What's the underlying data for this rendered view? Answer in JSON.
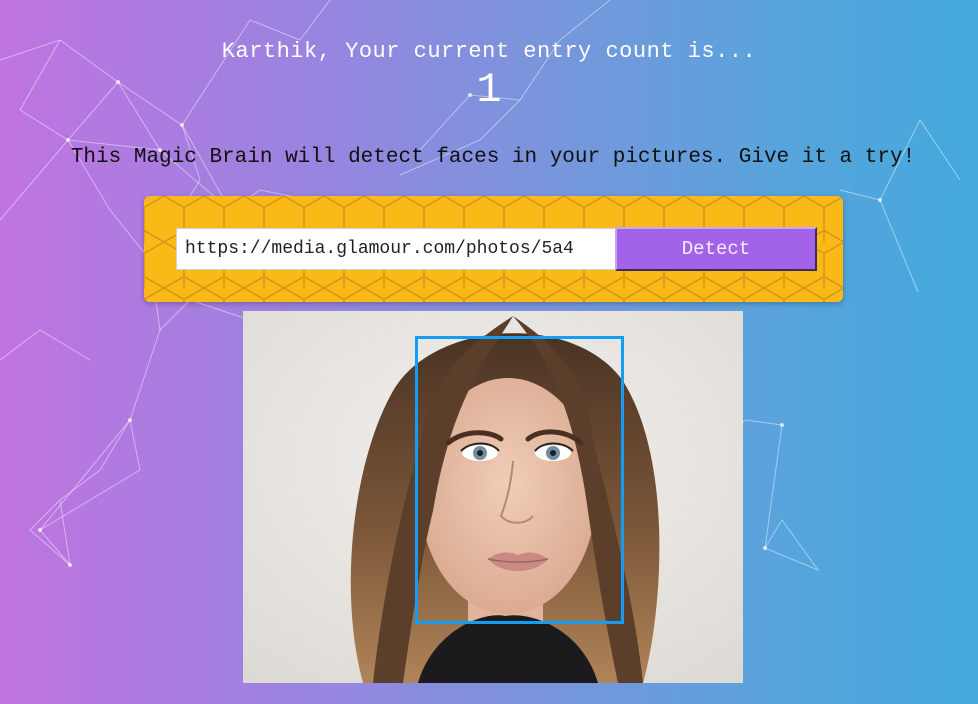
{
  "header": {
    "greeting": "Karthik, Your current entry count is...",
    "entry_count": "1"
  },
  "intro_text": "This Magic Brain will detect faces in your pictures. Give it a try!",
  "form": {
    "url_value": "https://media.glamour.com/photos/5a4",
    "detect_label": "Detect"
  },
  "result": {
    "faces_detected": 1,
    "face_box_color": "#149df2"
  },
  "colors": {
    "gradient_left": "#c074e0",
    "gradient_right": "#43a9dc",
    "panel": "#fbb917",
    "button": "#a363e8"
  }
}
